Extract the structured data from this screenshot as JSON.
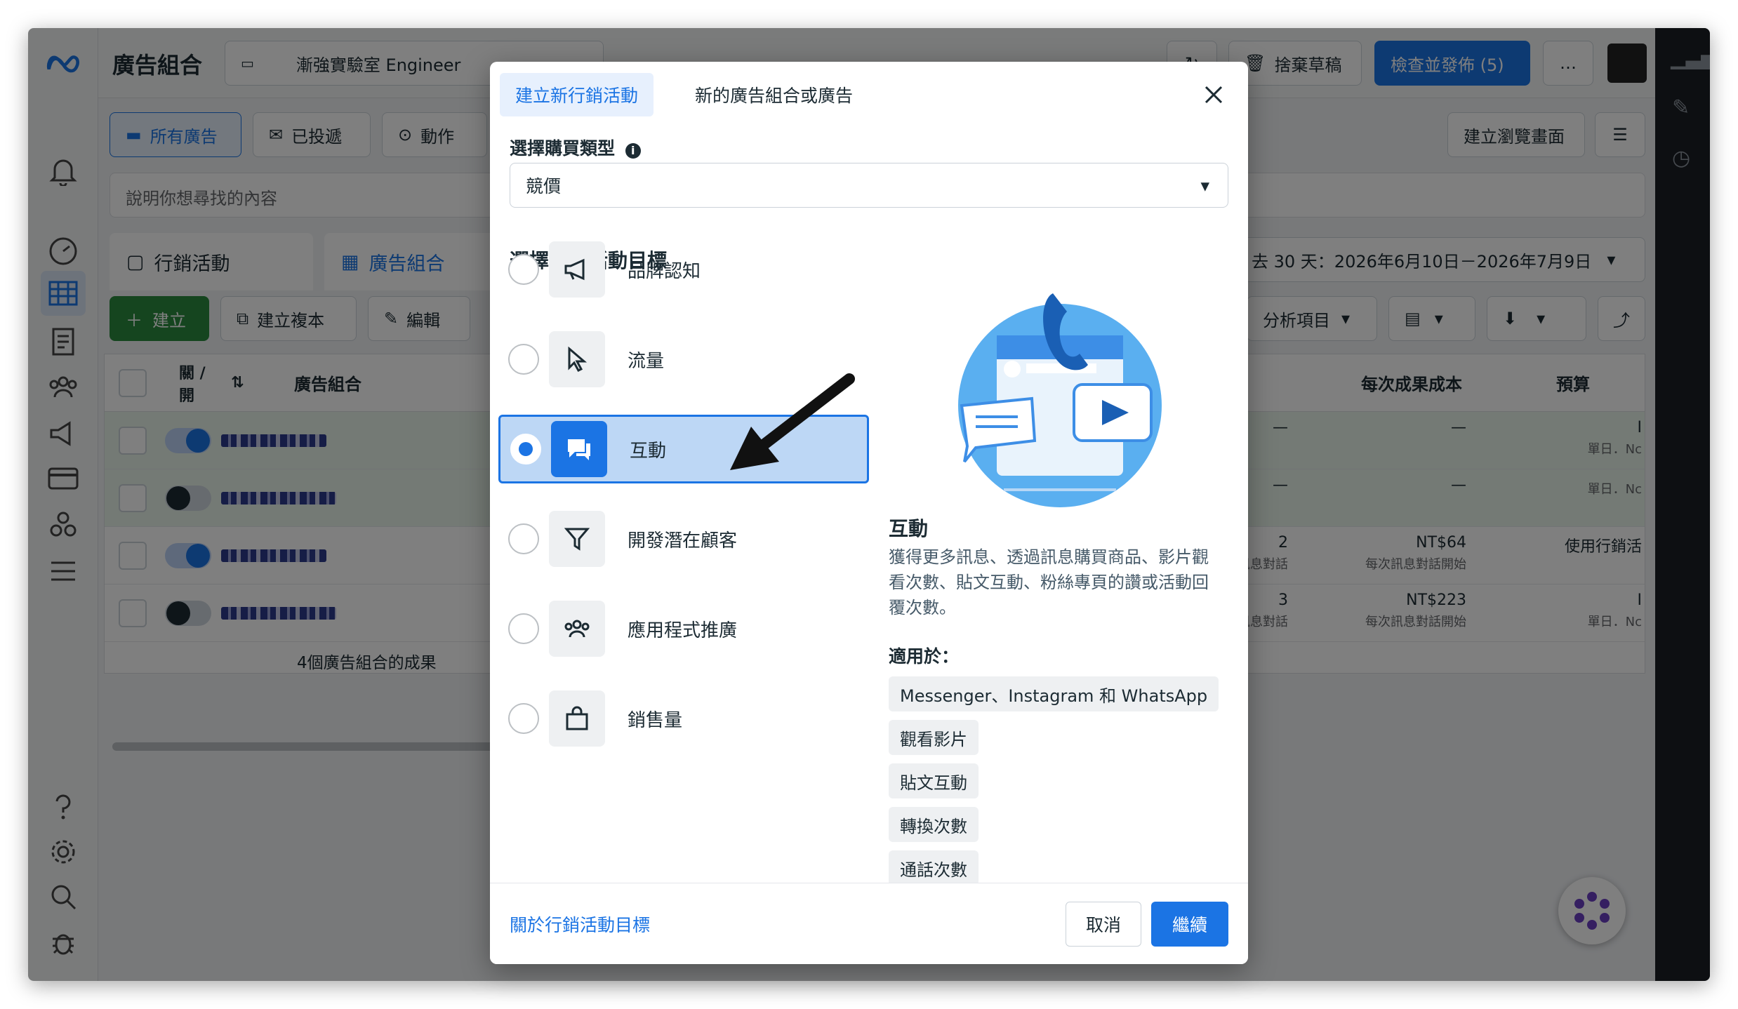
{
  "app": {
    "title": "廣告組合",
    "account_name": "漸強實驗室 Engineer",
    "draft_button": "捨棄草稿",
    "publish_button": "檢查並發佈 (5)",
    "more_button": "…",
    "view_button": "建立瀏覽畫面"
  },
  "filters": {
    "all_ads": "所有廣告",
    "delivered": "已投遞",
    "actions": "動作",
    "search_placeholder": "說明你想尋找的內容"
  },
  "levels": {
    "campaigns": "行銷活動",
    "ad_sets": "廣告組合",
    "date_range": "去 30 天：2026年6月10日－2026年7月9日"
  },
  "toolbar": {
    "create": "建立",
    "duplicate": "建立複本",
    "edit": "編輯",
    "breakdown": "分析項目"
  },
  "table": {
    "col_toggle": "關 / 開",
    "col_name": "廣告組合",
    "col_cost": "每次成果成本",
    "col_budget": "預算",
    "rows": [
      {
        "on": true,
        "result": "—",
        "result_sub": "",
        "cost": "—",
        "cost_sub": "",
        "budget": "I",
        "budget_sub": "單日．Nc"
      },
      {
        "on": false,
        "result": "—",
        "result_sub": "",
        "cost": "—",
        "cost_sub": "",
        "budget": "",
        "budget_sub": "單日．Nc"
      },
      {
        "on": true,
        "result": "2",
        "result_sub": "開始訊息對話",
        "cost": "NT$64",
        "cost_sub": "每次訊息對話開始",
        "budget": "使用行銷活",
        "budget_sub": ""
      },
      {
        "on": false,
        "result": "3",
        "result_sub": "開始訊息對話",
        "cost": "NT$223",
        "cost_sub": "每次訊息對話開始",
        "budget": "I",
        "budget_sub": "單日．Nc"
      }
    ],
    "summary": "4個廣告組合的成果"
  },
  "modal": {
    "tab_new_campaign": "建立新行銷活動",
    "tab_new_adset": "新的廣告組合或廣告",
    "buy_type_label": "選擇購買類型",
    "buy_type_value": "競價",
    "objective_label": "選擇行銷活動目標",
    "objectives": [
      {
        "label": "品牌認知",
        "icon": "megaphone-icon",
        "selected": false
      },
      {
        "label": "流量",
        "icon": "cursor-icon",
        "selected": false
      },
      {
        "label": "互動",
        "icon": "chat-bubbles-icon",
        "selected": true
      },
      {
        "label": "開發潛在顧客",
        "icon": "funnel-icon",
        "selected": false
      },
      {
        "label": "應用程式推廣",
        "icon": "people-icon",
        "selected": false
      },
      {
        "label": "銷售量",
        "icon": "shopping-bag-icon",
        "selected": false
      }
    ],
    "detail_title": "互動",
    "detail_desc": "獲得更多訊息、透過訊息購買商品、影片觀看次數、貼文互動、粉絲專頁的讚或活動回覆次數。",
    "applies_label": "適用於：",
    "applies": [
      "Messenger、Instagram 和 WhatsApp",
      "觀看影片",
      "貼文互動",
      "轉換次數",
      "通話次數"
    ],
    "learn_link": "關於行銷活動目標",
    "cancel": "取消",
    "continue": "繼續"
  },
  "colors": {
    "accent": "#1b74e4",
    "selected_bg": "#bdd7f5",
    "create_green": "#2a8a3e"
  }
}
